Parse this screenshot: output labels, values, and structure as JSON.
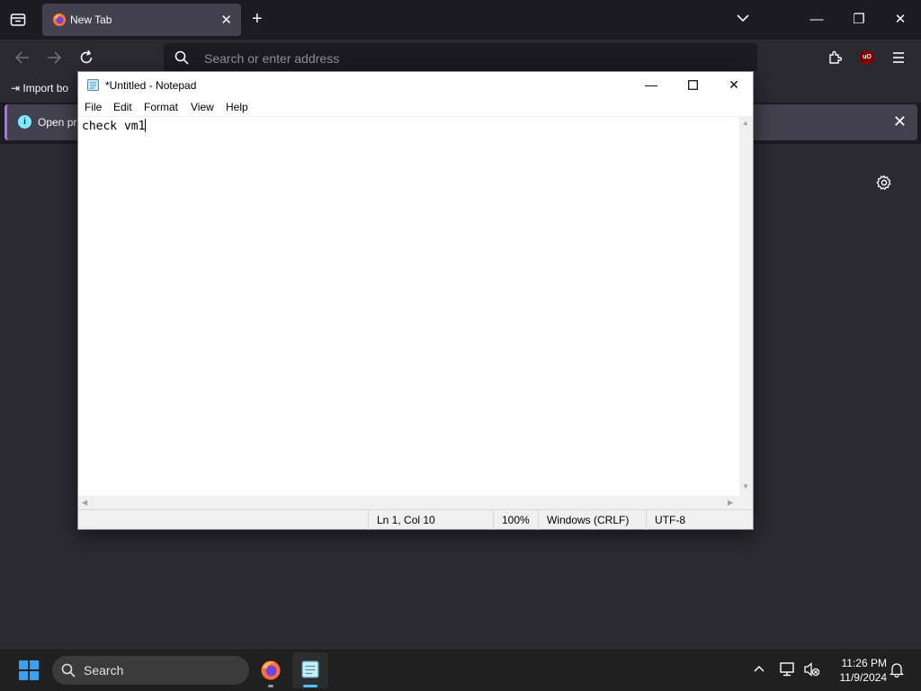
{
  "browser": {
    "tab_title": "New Tab",
    "url_placeholder": "Search or enter address",
    "bookmark_label": "Import bo",
    "infobar_text": "Open pr",
    "ublock_badge": "uO"
  },
  "notepad": {
    "window_title": "*Untitled - Notepad",
    "menu": [
      "File",
      "Edit",
      "Format",
      "View",
      "Help"
    ],
    "content": "check vm1",
    "status": {
      "position": "Ln 1, Col 10",
      "zoom": "100%",
      "line_ending": "Windows (CRLF)",
      "encoding": "UTF-8"
    }
  },
  "taskbar": {
    "search_label": "Search",
    "time": "11:26 PM",
    "date": "11/9/2024"
  },
  "colors": {
    "firefox_dark": "#1c1b22",
    "toolbar": "#2b2a33",
    "tab_active": "#42414d",
    "accent_purple": "#a970ff",
    "windows_blue": "#3aa0f0"
  }
}
